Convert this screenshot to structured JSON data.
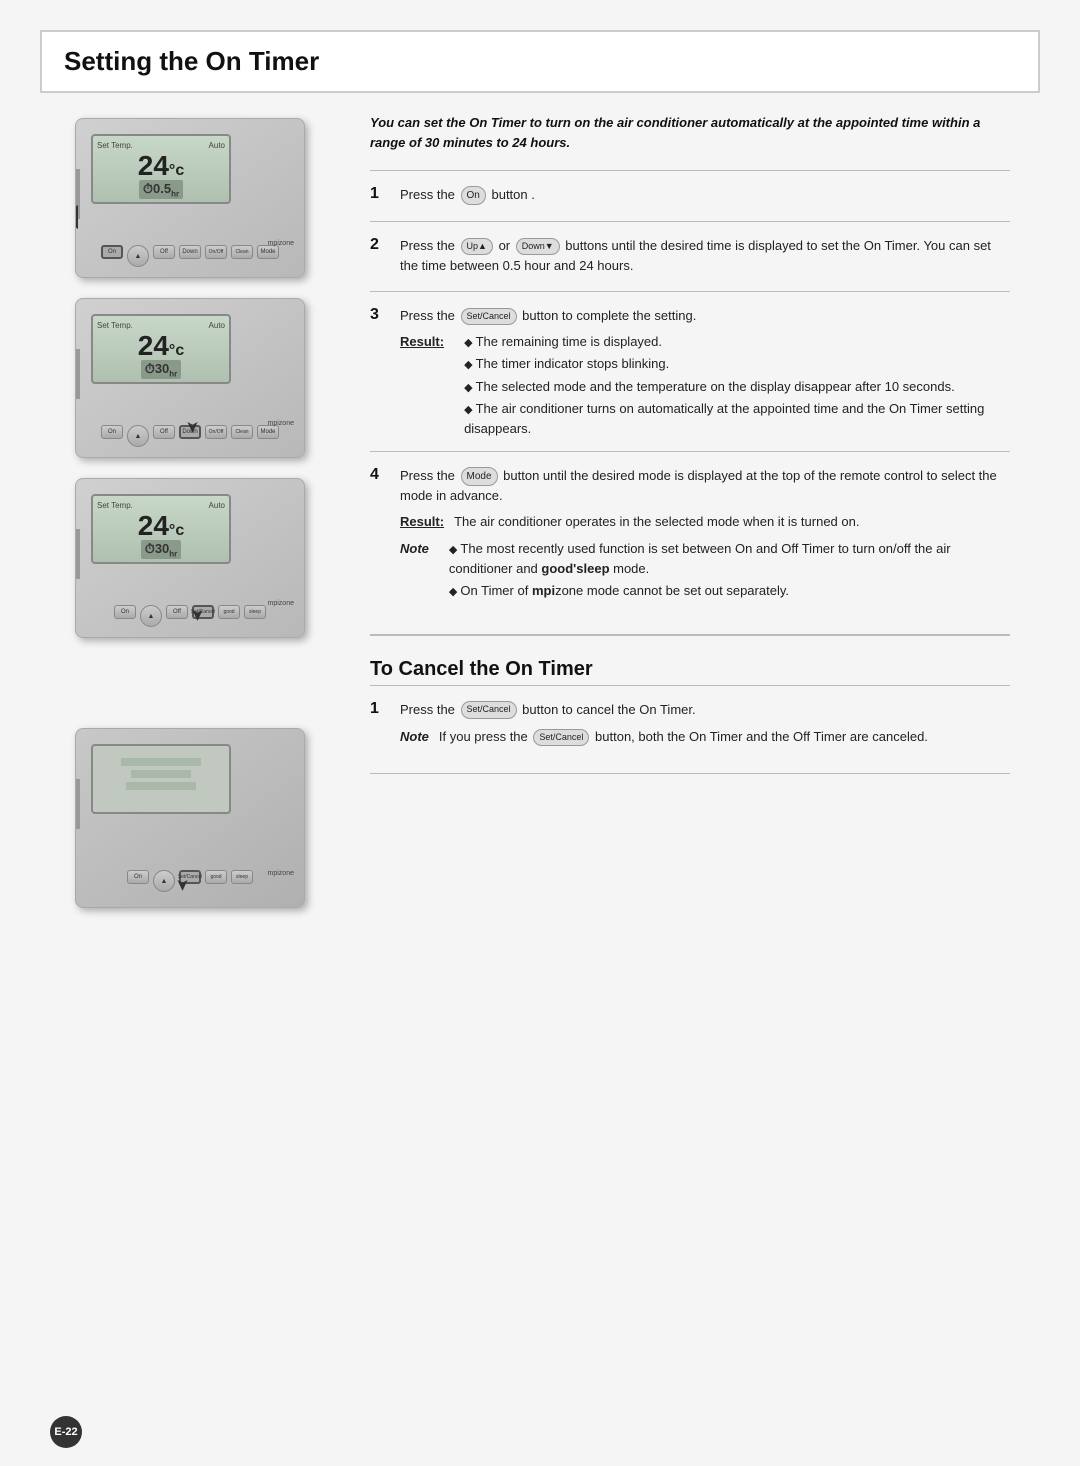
{
  "page": {
    "title": "Setting the On Timer",
    "page_number": "E-22",
    "background_color": "#f0f0f0"
  },
  "intro": {
    "text": "You can set the On Timer to turn on the air conditioner automatically at the appointed time within a range of 30 minutes to 24 hours."
  },
  "steps": [
    {
      "number": "1",
      "text": "Press the  button .",
      "button_label": "On"
    },
    {
      "number": "2",
      "text": "Press the  or  buttons until the desired time is displayed to set the On Timer. You can set the time between 0.5 hour and 24 hours.",
      "button_up": "Up",
      "button_down": "Down"
    },
    {
      "number": "3",
      "text": "Press the  button to complete the setting.",
      "button_label": "Set/Cancel",
      "result_label": "Result:",
      "result_bullets": [
        "The remaining time is displayed.",
        "The timer indicator stops blinking.",
        "The selected mode and the temperature on the display disappear after 10 seconds.",
        "The air conditioner turns on automatically at the appointed time and the On Timer setting disappears."
      ]
    },
    {
      "number": "4",
      "text": "Press the  button until the desired mode is displayed at the top of the remote control to select the mode in advance.",
      "button_label": "Mode",
      "result_label": "Result:",
      "result_text": "The air conditioner operates in the selected mode when it is turned on.",
      "note_label": "Note",
      "note_bullets": [
        "The most recently used function is set between On and Off Timer to turn on/off the air conditioner and good'sleep mode.",
        "On Timer of mpizone mode cannot be set out separately."
      ]
    }
  ],
  "cancel_section": {
    "heading": "To Cancel the On Timer",
    "steps": [
      {
        "number": "1",
        "text": "Press the  button to cancel the On Timer.",
        "button_label": "Set/Cancel",
        "note_label": "Note",
        "note_text": "If you press the  button, both the On Timer and the Off Timer are canceled.",
        "note_button_label": "Set/Cancel"
      }
    ]
  },
  "remotes": [
    {
      "id": "remote1",
      "temp": "24",
      "timer": "0.5hr",
      "mode": "Auto",
      "label": "Set Temp.",
      "timer_icon": "0.5",
      "highlight_btn": "On"
    },
    {
      "id": "remote2",
      "temp": "24",
      "timer": "30hr",
      "mode": "Auto",
      "label": "Set Temp.",
      "timer_icon": "30",
      "highlight_btn": "Down"
    },
    {
      "id": "remote3",
      "temp": "24",
      "timer": "30hr",
      "mode": "Auto",
      "label": "Set Temp.",
      "timer_icon": "30",
      "highlight_btn": "Set/Cancel"
    },
    {
      "id": "remote4",
      "temp": "",
      "timer": "",
      "mode": "",
      "label": "",
      "highlight_btn": "Set/Cancel"
    }
  ]
}
